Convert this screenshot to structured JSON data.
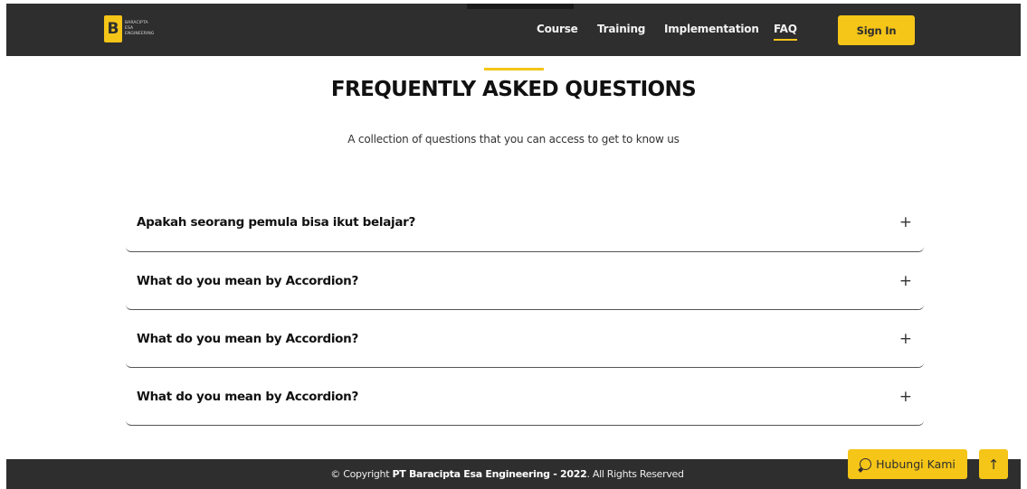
{
  "navbar": {
    "logo": {
      "mark": "B",
      "lines": [
        "BARACIPTA",
        "ESA",
        "ENGINEERING"
      ]
    },
    "links": [
      {
        "label": "Course",
        "active": false
      },
      {
        "label": "Training",
        "active": false
      },
      {
        "label": "Implementation",
        "active": false
      },
      {
        "label": "FAQ",
        "active": true
      }
    ],
    "sign_in_label": "Sign In"
  },
  "faq": {
    "title": "FREQUENTLY ASKED QUESTIONS",
    "subtitle": "A collection of questions that you can access to get to know us",
    "items": [
      {
        "question": "Apakah seorang pemula bisa ikut belajar?",
        "expand_icon": "+"
      },
      {
        "question": "What do you mean by Accordion?",
        "expand_icon": "+"
      },
      {
        "question": "What do you mean by Accordion?",
        "expand_icon": "+"
      },
      {
        "question": "What do you mean by Accordion?",
        "expand_icon": "+"
      }
    ]
  },
  "footer": {
    "prefix": "© Copyright ",
    "company": "PT Baracipta Esa Engineering - 2022",
    "suffix": ". All Rights Reserved"
  },
  "floating": {
    "whatsapp_label": "Hubungi Kami",
    "whatsapp_icon": "whatsapp-icon",
    "scroll_top_icon": "arrow-up-icon",
    "scroll_top_glyph": "↑"
  },
  "colors": {
    "accent": "#f5c518",
    "dark": "#2e2e2e",
    "background": "#ffffff"
  }
}
